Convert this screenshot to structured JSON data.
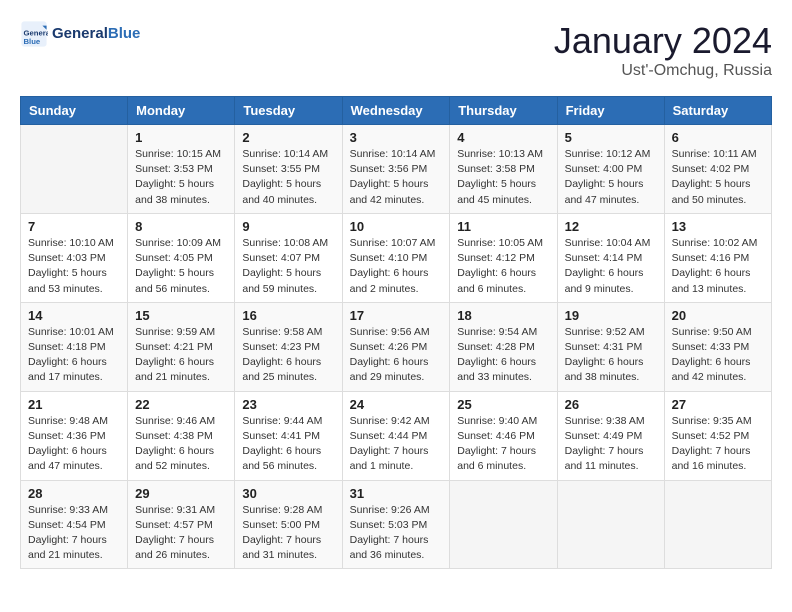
{
  "header": {
    "logo_line1": "General",
    "logo_line2": "Blue",
    "month": "January 2024",
    "location": "Ust'-Omchug, Russia"
  },
  "weekdays": [
    "Sunday",
    "Monday",
    "Tuesday",
    "Wednesday",
    "Thursday",
    "Friday",
    "Saturday"
  ],
  "weeks": [
    [
      {
        "day": "",
        "info": ""
      },
      {
        "day": "1",
        "info": "Sunrise: 10:15 AM\nSunset: 3:53 PM\nDaylight: 5 hours\nand 38 minutes."
      },
      {
        "day": "2",
        "info": "Sunrise: 10:14 AM\nSunset: 3:55 PM\nDaylight: 5 hours\nand 40 minutes."
      },
      {
        "day": "3",
        "info": "Sunrise: 10:14 AM\nSunset: 3:56 PM\nDaylight: 5 hours\nand 42 minutes."
      },
      {
        "day": "4",
        "info": "Sunrise: 10:13 AM\nSunset: 3:58 PM\nDaylight: 5 hours\nand 45 minutes."
      },
      {
        "day": "5",
        "info": "Sunrise: 10:12 AM\nSunset: 4:00 PM\nDaylight: 5 hours\nand 47 minutes."
      },
      {
        "day": "6",
        "info": "Sunrise: 10:11 AM\nSunset: 4:02 PM\nDaylight: 5 hours\nand 50 minutes."
      }
    ],
    [
      {
        "day": "7",
        "info": "Sunrise: 10:10 AM\nSunset: 4:03 PM\nDaylight: 5 hours\nand 53 minutes."
      },
      {
        "day": "8",
        "info": "Sunrise: 10:09 AM\nSunset: 4:05 PM\nDaylight: 5 hours\nand 56 minutes."
      },
      {
        "day": "9",
        "info": "Sunrise: 10:08 AM\nSunset: 4:07 PM\nDaylight: 5 hours\nand 59 minutes."
      },
      {
        "day": "10",
        "info": "Sunrise: 10:07 AM\nSunset: 4:10 PM\nDaylight: 6 hours\nand 2 minutes."
      },
      {
        "day": "11",
        "info": "Sunrise: 10:05 AM\nSunset: 4:12 PM\nDaylight: 6 hours\nand 6 minutes."
      },
      {
        "day": "12",
        "info": "Sunrise: 10:04 AM\nSunset: 4:14 PM\nDaylight: 6 hours\nand 9 minutes."
      },
      {
        "day": "13",
        "info": "Sunrise: 10:02 AM\nSunset: 4:16 PM\nDaylight: 6 hours\nand 13 minutes."
      }
    ],
    [
      {
        "day": "14",
        "info": "Sunrise: 10:01 AM\nSunset: 4:18 PM\nDaylight: 6 hours\nand 17 minutes."
      },
      {
        "day": "15",
        "info": "Sunrise: 9:59 AM\nSunset: 4:21 PM\nDaylight: 6 hours\nand 21 minutes."
      },
      {
        "day": "16",
        "info": "Sunrise: 9:58 AM\nSunset: 4:23 PM\nDaylight: 6 hours\nand 25 minutes."
      },
      {
        "day": "17",
        "info": "Sunrise: 9:56 AM\nSunset: 4:26 PM\nDaylight: 6 hours\nand 29 minutes."
      },
      {
        "day": "18",
        "info": "Sunrise: 9:54 AM\nSunset: 4:28 PM\nDaylight: 6 hours\nand 33 minutes."
      },
      {
        "day": "19",
        "info": "Sunrise: 9:52 AM\nSunset: 4:31 PM\nDaylight: 6 hours\nand 38 minutes."
      },
      {
        "day": "20",
        "info": "Sunrise: 9:50 AM\nSunset: 4:33 PM\nDaylight: 6 hours\nand 42 minutes."
      }
    ],
    [
      {
        "day": "21",
        "info": "Sunrise: 9:48 AM\nSunset: 4:36 PM\nDaylight: 6 hours\nand 47 minutes."
      },
      {
        "day": "22",
        "info": "Sunrise: 9:46 AM\nSunset: 4:38 PM\nDaylight: 6 hours\nand 52 minutes."
      },
      {
        "day": "23",
        "info": "Sunrise: 9:44 AM\nSunset: 4:41 PM\nDaylight: 6 hours\nand 56 minutes."
      },
      {
        "day": "24",
        "info": "Sunrise: 9:42 AM\nSunset: 4:44 PM\nDaylight: 7 hours\nand 1 minute."
      },
      {
        "day": "25",
        "info": "Sunrise: 9:40 AM\nSunset: 4:46 PM\nDaylight: 7 hours\nand 6 minutes."
      },
      {
        "day": "26",
        "info": "Sunrise: 9:38 AM\nSunset: 4:49 PM\nDaylight: 7 hours\nand 11 minutes."
      },
      {
        "day": "27",
        "info": "Sunrise: 9:35 AM\nSunset: 4:52 PM\nDaylight: 7 hours\nand 16 minutes."
      }
    ],
    [
      {
        "day": "28",
        "info": "Sunrise: 9:33 AM\nSunset: 4:54 PM\nDaylight: 7 hours\nand 21 minutes."
      },
      {
        "day": "29",
        "info": "Sunrise: 9:31 AM\nSunset: 4:57 PM\nDaylight: 7 hours\nand 26 minutes."
      },
      {
        "day": "30",
        "info": "Sunrise: 9:28 AM\nSunset: 5:00 PM\nDaylight: 7 hours\nand 31 minutes."
      },
      {
        "day": "31",
        "info": "Sunrise: 9:26 AM\nSunset: 5:03 PM\nDaylight: 7 hours\nand 36 minutes."
      },
      {
        "day": "",
        "info": ""
      },
      {
        "day": "",
        "info": ""
      },
      {
        "day": "",
        "info": ""
      }
    ]
  ]
}
